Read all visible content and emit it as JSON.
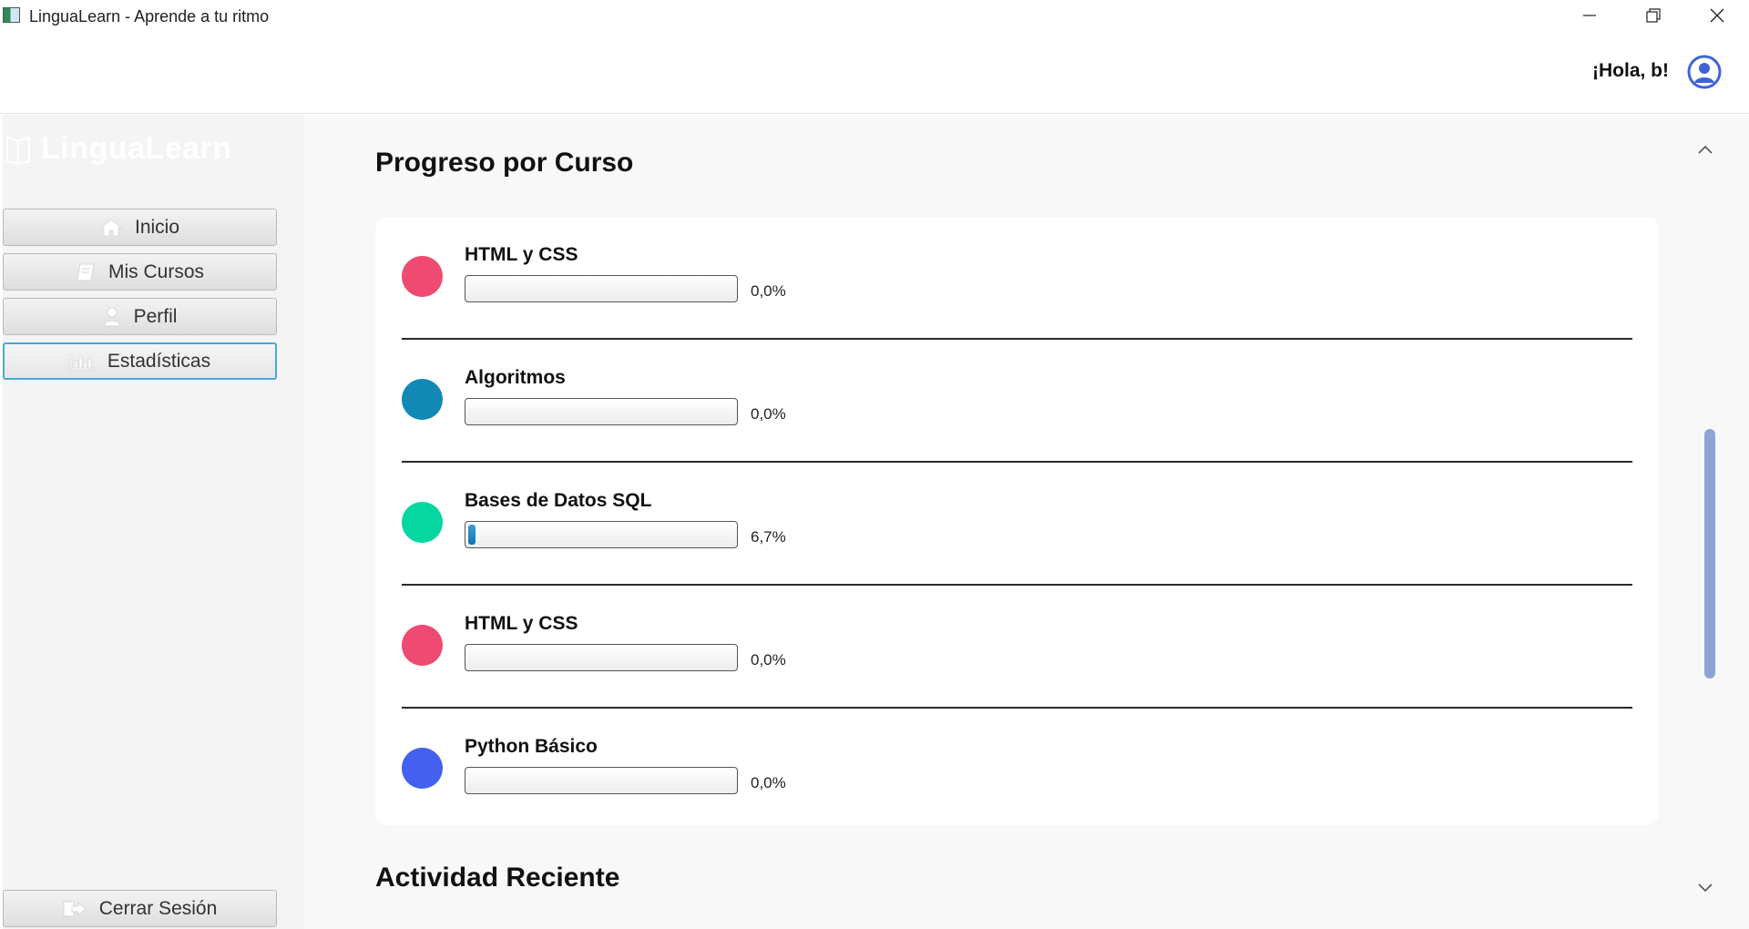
{
  "window": {
    "title": "LinguaLearn - Aprende a tu ritmo"
  },
  "header": {
    "greeting": "¡Hola, b!"
  },
  "sidebar": {
    "brand": "LinguaLearn",
    "items": [
      {
        "label": "Inicio",
        "icon": "home-icon"
      },
      {
        "label": "Mis Cursos",
        "icon": "book-icon"
      },
      {
        "label": "Perfil",
        "icon": "user-icon"
      },
      {
        "label": "Estadísticas",
        "icon": "bar-chart-icon",
        "active": true
      }
    ],
    "logout": {
      "label": "Cerrar Sesión",
      "icon": "logout-icon"
    }
  },
  "main": {
    "progress_title": "Progreso por Curso",
    "activity_title": "Actividad Reciente",
    "courses": [
      {
        "name": "HTML y CSS",
        "progress_label": "0,0%",
        "progress": 0.0,
        "color": "#ef4a72"
      },
      {
        "name": "Algoritmos",
        "progress_label": "0,0%",
        "progress": 0.0,
        "color": "#1288b5"
      },
      {
        "name": "Bases de Datos SQL",
        "progress_label": "6,7%",
        "progress": 0.067,
        "color": "#06d6a0"
      },
      {
        "name": "HTML y CSS",
        "progress_label": "0,0%",
        "progress": 0.0,
        "color": "#ef4a72"
      },
      {
        "name": "Python Básico",
        "progress_label": "0,0%",
        "progress": 0.0,
        "color": "#4361ee"
      }
    ]
  }
}
